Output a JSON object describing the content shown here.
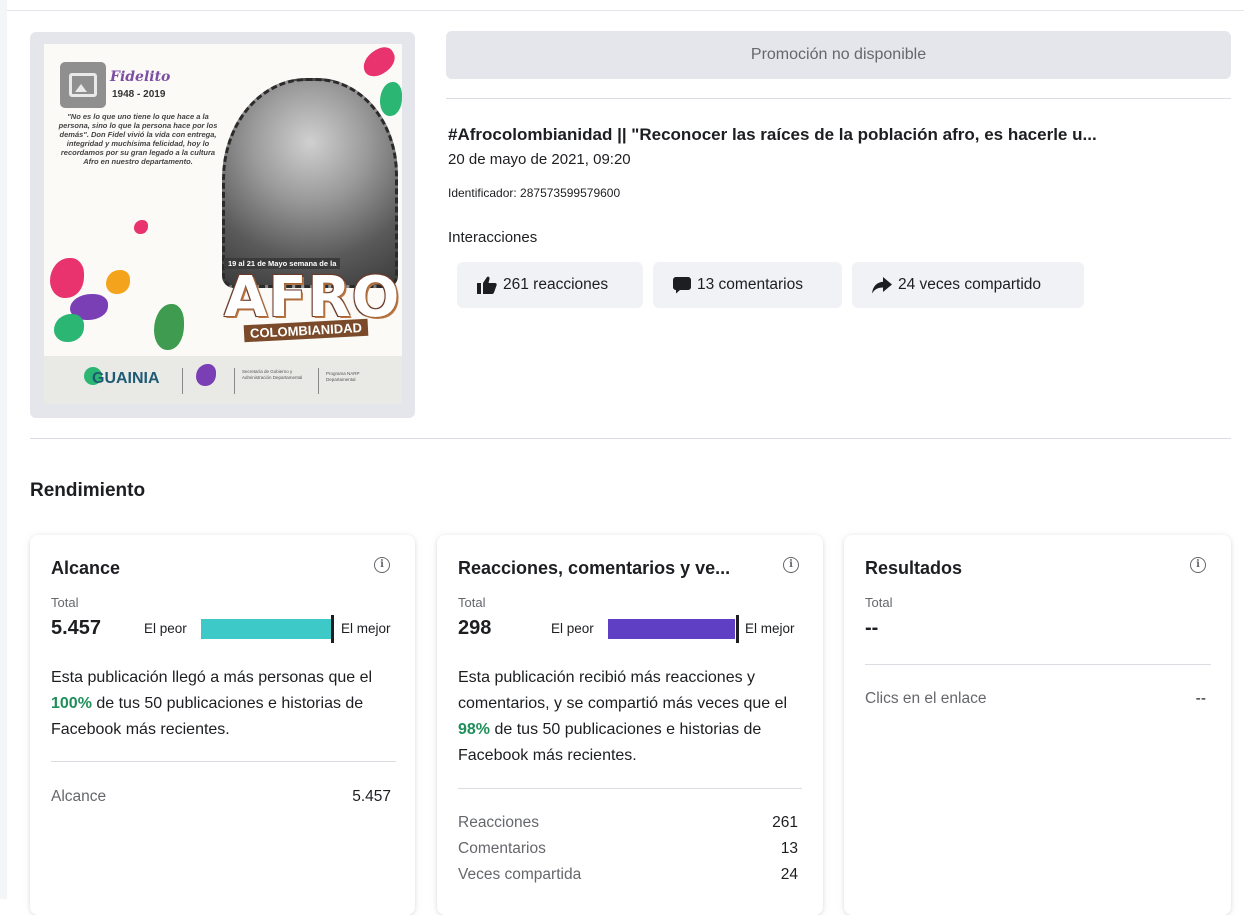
{
  "post": {
    "image": {
      "name": "Fidelito",
      "years": "1948 - 2019",
      "quote": "\"No es lo que uno tiene lo que hace a la persona, sino lo que la persona hace por los demás\". Don Fidel vivió la vida con entrega, integridad y muchísima felicidad, hoy lo recordamos por su gran legado a la cultura Afro en nuestro departamento.",
      "week_label": "19 al 21 de Mayo semana de la",
      "headline": "AFRO",
      "subheadline": "COLOMBIANIDAD",
      "logo_text": "GUAINIA",
      "footer_secretary": "Secretaría de Gobierno y Administración Departamental",
      "footer_program": "Programa NARP Departamental"
    },
    "promotion_label": "Promoción no disponible",
    "title": "#Afrocolombianidad || \"Reconocer las raíces de la población afro, es hacerle u...",
    "date": "20 de mayo de 2021, 09:20",
    "identifier": "Identificador: 287573599579600",
    "interactions_label": "Interacciones",
    "interactions": {
      "reactions": "261 reacciones",
      "comments": "13 comentarios",
      "shares": "24 veces compartido"
    }
  },
  "performance": {
    "title": "Rendimiento",
    "cards": [
      {
        "title": "Alcance",
        "total_label": "Total",
        "total": "5.457",
        "worst_label": "El peor",
        "best_label": "El mejor",
        "bar_fraction": 1.0,
        "bar_color": "#3ec9c9",
        "desc_before": "Esta publicación llegó a más personas que el ",
        "desc_pct": "100%",
        "desc_after": " de tus 50 publicaciones e historias de Facebook más recientes.",
        "rows": [
          {
            "label": "Alcance",
            "value": "5.457"
          }
        ]
      },
      {
        "title": "Reacciones, comentarios y ve...",
        "total_label": "Total",
        "total": "298",
        "worst_label": "El peor",
        "best_label": "El mejor",
        "bar_fraction": 0.98,
        "bar_color": "#5f3fc4",
        "desc_before": "Esta publicación recibió más reacciones y comentarios, y se compartió más veces que el ",
        "desc_pct": "98%",
        "desc_after": " de tus 50 publicaciones e historias de Facebook más recientes.",
        "rows": [
          {
            "label": "Reacciones",
            "value": "261"
          },
          {
            "label": "Comentarios",
            "value": "13"
          },
          {
            "label": "Veces compartida",
            "value": "24"
          }
        ]
      },
      {
        "title": "Resultados",
        "total_label": "Total",
        "total": "--",
        "rows": [
          {
            "label": "Clics en el enlace",
            "value": "--"
          }
        ]
      }
    ]
  },
  "icons": {
    "thumb": "thumbs-up-icon",
    "comment": "comment-bubble-icon",
    "share": "share-arrow-icon",
    "info": "info-icon",
    "image_placeholder": "image-placeholder-icon"
  },
  "colors": {
    "accent_green": "#1f8f5a",
    "reach_bar": "#3ec9c9",
    "engagement_bar": "#5f3fc4"
  }
}
